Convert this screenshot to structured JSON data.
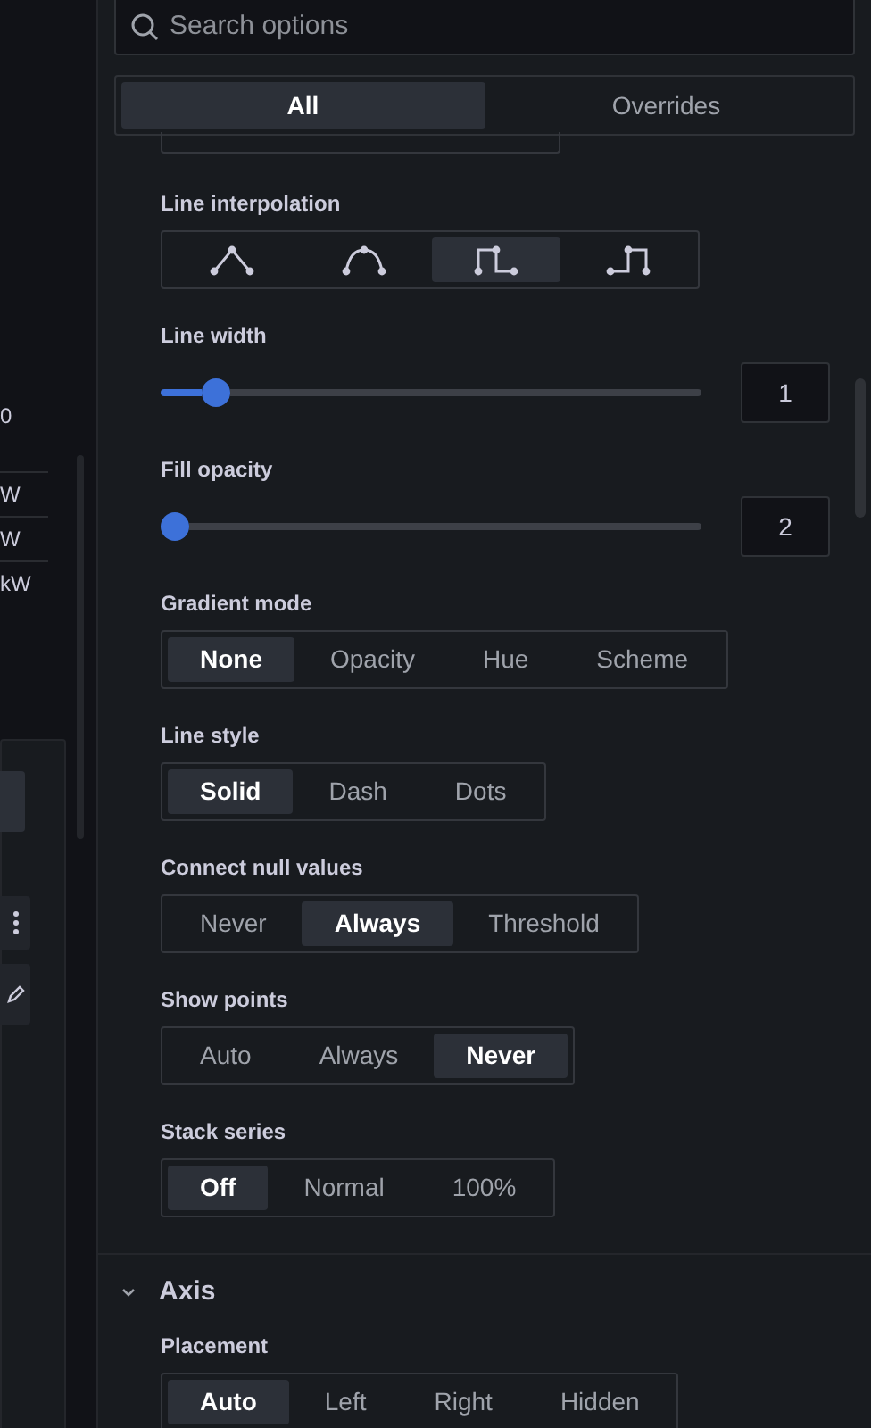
{
  "left_panel": {
    "texts": [
      "0",
      "W",
      "W",
      "kW"
    ]
  },
  "search": {
    "placeholder": "Search options"
  },
  "tabs": [
    {
      "label": "All",
      "selected": true
    },
    {
      "label": "Overrides",
      "selected": false
    }
  ],
  "options": [
    {
      "kind": "icons",
      "label": "Line interpolation",
      "choices": [
        {
          "selected": false
        },
        {
          "selected": false
        },
        {
          "selected": true
        },
        {
          "selected": false
        }
      ]
    },
    {
      "kind": "slider",
      "label": "Line width",
      "level": 0.08,
      "value": "1"
    },
    {
      "kind": "slider",
      "label": "Fill opacity",
      "level": 0,
      "value": "2"
    },
    {
      "kind": "radio",
      "label": "Gradient mode",
      "choices": [
        {
          "label": "None",
          "selected": true
        },
        {
          "label": "Opacity",
          "selected": false
        },
        {
          "label": "Hue",
          "selected": false
        },
        {
          "label": "Scheme",
          "selected": false
        }
      ]
    },
    {
      "kind": "radio",
      "label": "Line style",
      "choices": [
        {
          "label": "Solid",
          "selected": true
        },
        {
          "label": "Dash",
          "selected": false
        },
        {
          "label": "Dots",
          "selected": false
        }
      ]
    },
    {
      "kind": "radio",
      "label": "Connect null values",
      "choices": [
        {
          "label": "Never",
          "selected": false
        },
        {
          "label": "Always",
          "selected": true
        },
        {
          "label": "Threshold",
          "selected": false
        }
      ]
    },
    {
      "kind": "radio",
      "label": "Show points",
      "choices": [
        {
          "label": "Auto",
          "selected": false
        },
        {
          "label": "Always",
          "selected": false
        },
        {
          "label": "Never",
          "selected": true
        }
      ]
    },
    {
      "kind": "radio",
      "label": "Stack series",
      "choices": [
        {
          "label": "Off",
          "selected": true
        },
        {
          "label": "Normal",
          "selected": false
        },
        {
          "label": "100%",
          "selected": false
        }
      ]
    }
  ],
  "axis_section": {
    "title": "Axis",
    "expanded": true,
    "options": [
      {
        "kind": "radio",
        "label": "Placement",
        "choices": [
          {
            "label": "Auto",
            "selected": true
          },
          {
            "label": "Left",
            "selected": false
          },
          {
            "label": "Right",
            "selected": false
          },
          {
            "label": "Hidden",
            "selected": false
          }
        ]
      }
    ]
  }
}
